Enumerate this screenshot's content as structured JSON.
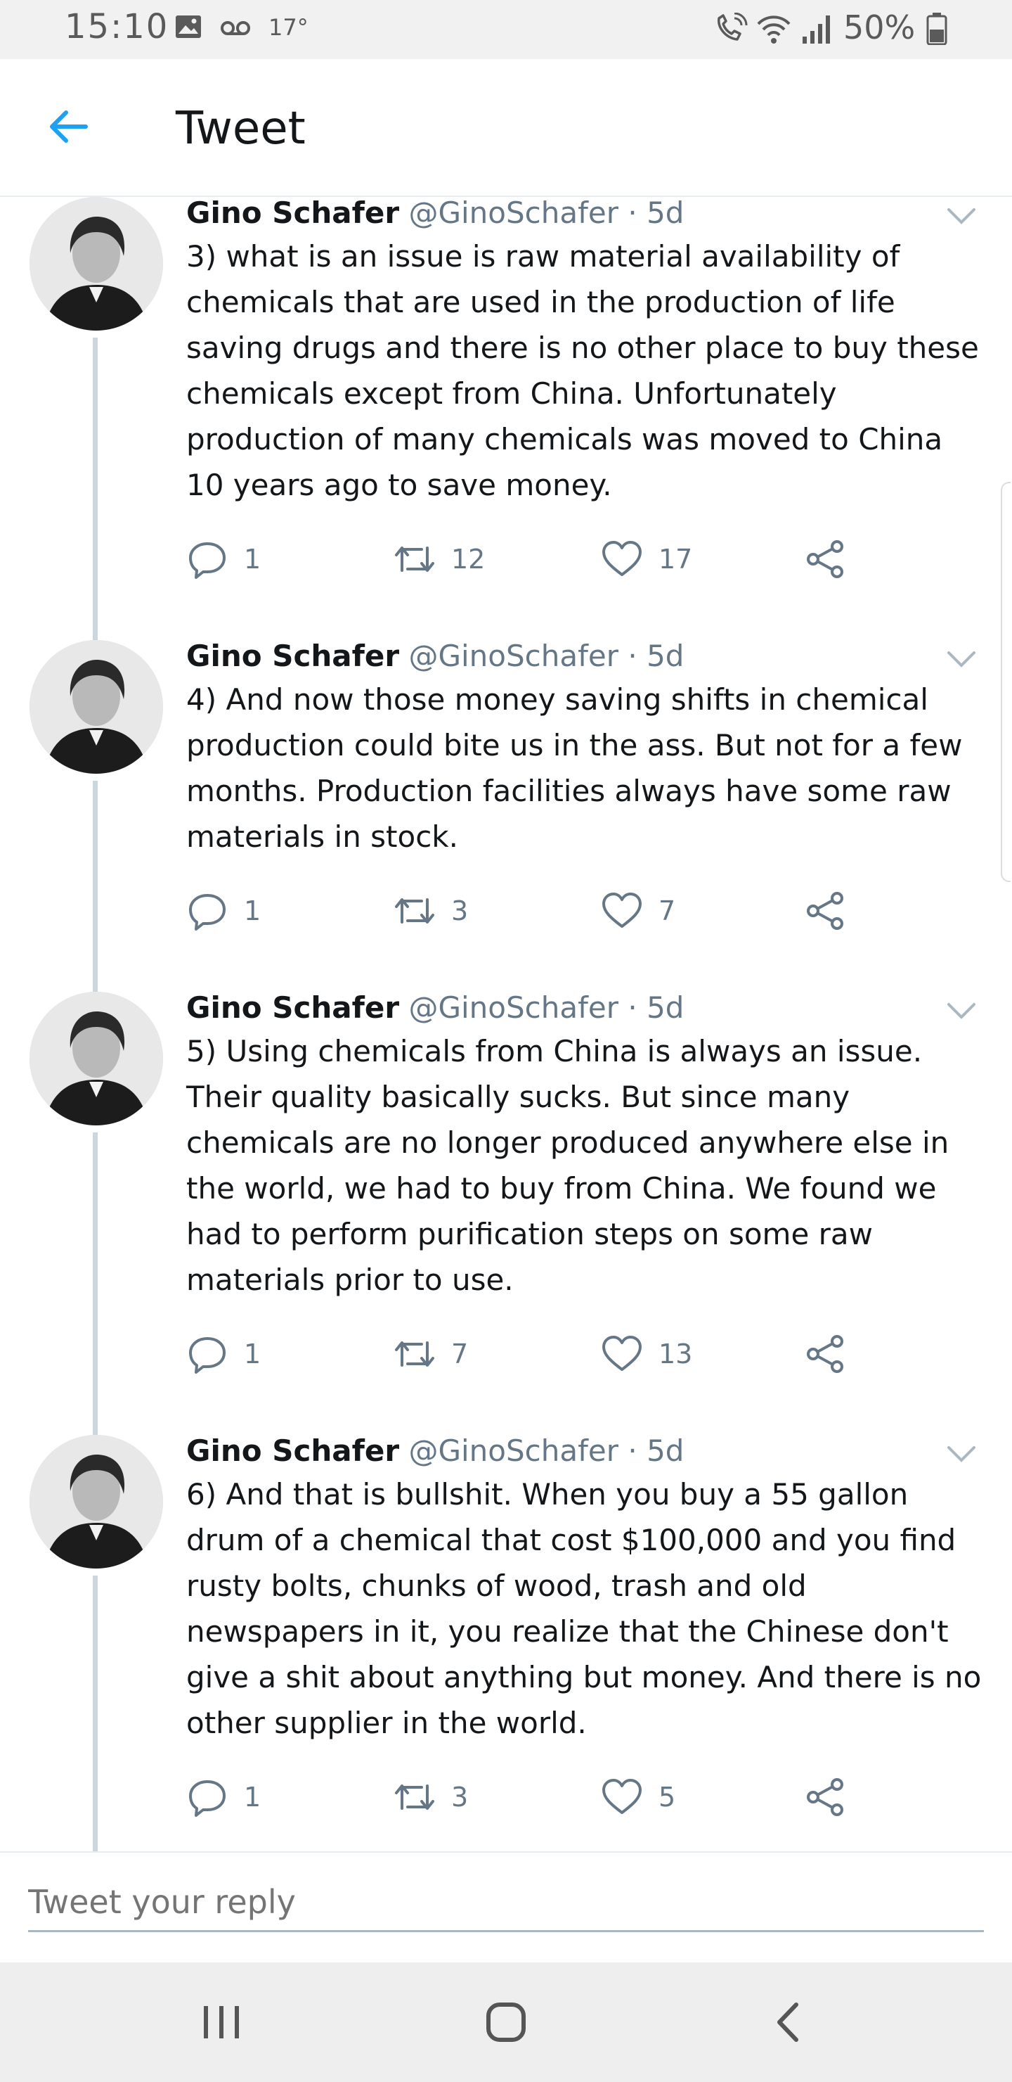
{
  "status_bar": {
    "time": "15:10",
    "temperature": "17°",
    "battery": "50%",
    "icons": [
      "image-icon",
      "voicemail-icon",
      "wifi-call-icon",
      "wifi-icon",
      "signal-icon",
      "battery-icon"
    ]
  },
  "header": {
    "title": "Tweet"
  },
  "tweets": [
    {
      "name": "Gino Schafer",
      "handle": "@GinoSchafer",
      "time": "· 5d",
      "text": "3) what is an issue is raw material availability of chemicals that are used in the production of life saving drugs and there is no other place to buy these chemicals except from China. Unfortunately production of many chemicals was moved to China 10 years ago to save money.",
      "replies": "1",
      "retweets": "12",
      "likes": "17"
    },
    {
      "name": "Gino Schafer",
      "handle": "@GinoSchafer",
      "time": "· 5d",
      "text": "4) And now those money saving shifts in chemical production could bite us in the ass. But not for a few months. Production facilities always have some raw materials in stock.",
      "replies": "1",
      "retweets": "3",
      "likes": "7"
    },
    {
      "name": "Gino Schafer",
      "handle": "@GinoSchafer",
      "time": "· 5d",
      "text": "5) Using chemicals from China is always an issue. Their quality basically sucks. But since many chemicals are no longer produced anywhere else in the world, we had to buy from China. We found we had to perform purification steps on some raw materials prior to use.",
      "replies": "1",
      "retweets": "7",
      "likes": "13"
    },
    {
      "name": "Gino Schafer",
      "handle": "@GinoSchafer",
      "time": "· 5d",
      "text": "6) And that is bullshit. When you buy a 55 gallon drum of a chemical that cost $100,000 and you find rusty bolts, chunks of wood, trash and old newspapers in it, you realize that the Chinese don't give a shit about anything but money. And there is no other supplier in the world.",
      "replies": "1",
      "retweets": "3",
      "likes": "5"
    }
  ],
  "reply": {
    "placeholder": "Tweet your reply"
  },
  "colors": {
    "accent": "#1da1f2",
    "muted": "#657786",
    "line": "#ccd6dd"
  }
}
